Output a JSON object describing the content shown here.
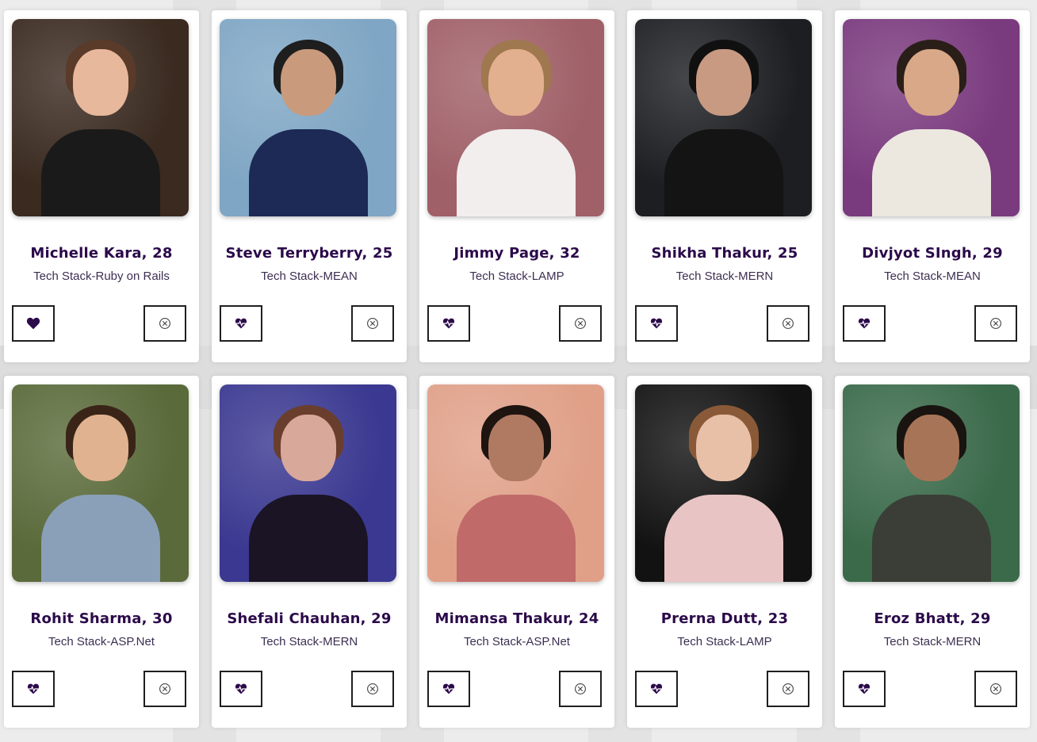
{
  "colors": {
    "name_text": "#2b0a4a",
    "stack_text": "#3c2f52",
    "heart": "#2b0a4a",
    "pass_icon": "#444444"
  },
  "profiles": [
    {
      "name": "Michelle Kara, 28",
      "stack": "Tech Stack-Ruby on Rails",
      "photo_bg": "#3a2a20",
      "skin": "#e8b89c",
      "hair": "#5a3a28",
      "shirt": "#1a1a1a",
      "like_icon": "heart-icon"
    },
    {
      "name": "Steve Terryberry, 25",
      "stack": "Tech Stack-MEAN",
      "photo_bg": "#7fa6c4",
      "skin": "#c99a7c",
      "hair": "#1e1e1e",
      "shirt": "#1c2a55",
      "like_icon": "heartbeat-icon"
    },
    {
      "name": "Jimmy Page, 32",
      "stack": "Tech Stack-LAMP",
      "photo_bg": "#a06068",
      "skin": "#e2b08e",
      "hair": "#a07850",
      "shirt": "#f2eeee",
      "like_icon": "heartbeat-icon"
    },
    {
      "name": "Shikha Thakur, 25",
      "stack": "Tech Stack-MERN",
      "photo_bg": "#1c1e22",
      "skin": "#c89a82",
      "hair": "#101010",
      "shirt": "#141414",
      "like_icon": "heartbeat-icon"
    },
    {
      "name": "Divjyot SIngh, 29",
      "stack": "Tech Stack-MEAN",
      "photo_bg": "#7a3a7e",
      "skin": "#d8a888",
      "hair": "#2a1e18",
      "shirt": "#ece8e0",
      "like_icon": "heartbeat-icon"
    },
    {
      "name": "Rohit Sharma, 30",
      "stack": "Tech Stack-ASP.Net",
      "photo_bg": "#5a6a3a",
      "skin": "#e0b290",
      "hair": "#3a2418",
      "shirt": "#8aa0b8",
      "like_icon": "heartbeat-icon"
    },
    {
      "name": "Shefali Chauhan, 29",
      "stack": "Tech Stack-MERN",
      "photo_bg": "#3a3890",
      "skin": "#d8a89a",
      "hair": "#6a3e2c",
      "shirt": "#1a1424",
      "like_icon": "heartbeat-icon"
    },
    {
      "name": "Mimansa Thakur, 24",
      "stack": "Tech Stack-ASP.Net",
      "photo_bg": "#e0a088",
      "skin": "#b07a62",
      "hair": "#1e1410",
      "shirt": "#c06a6a",
      "like_icon": "heartbeat-icon"
    },
    {
      "name": "Prerna Dutt, 23",
      "stack": "Tech Stack-LAMP",
      "photo_bg": "#121212",
      "skin": "#e8c0a8",
      "hair": "#8a5a38",
      "shirt": "#e8c4c4",
      "like_icon": "heartbeat-icon"
    },
    {
      "name": "Eroz Bhatt, 29",
      "stack": "Tech Stack-MERN",
      "photo_bg": "#3a6a4a",
      "skin": "#a87458",
      "hair": "#1a1410",
      "shirt": "#3a3e36",
      "like_icon": "heartbeat-icon"
    }
  ]
}
